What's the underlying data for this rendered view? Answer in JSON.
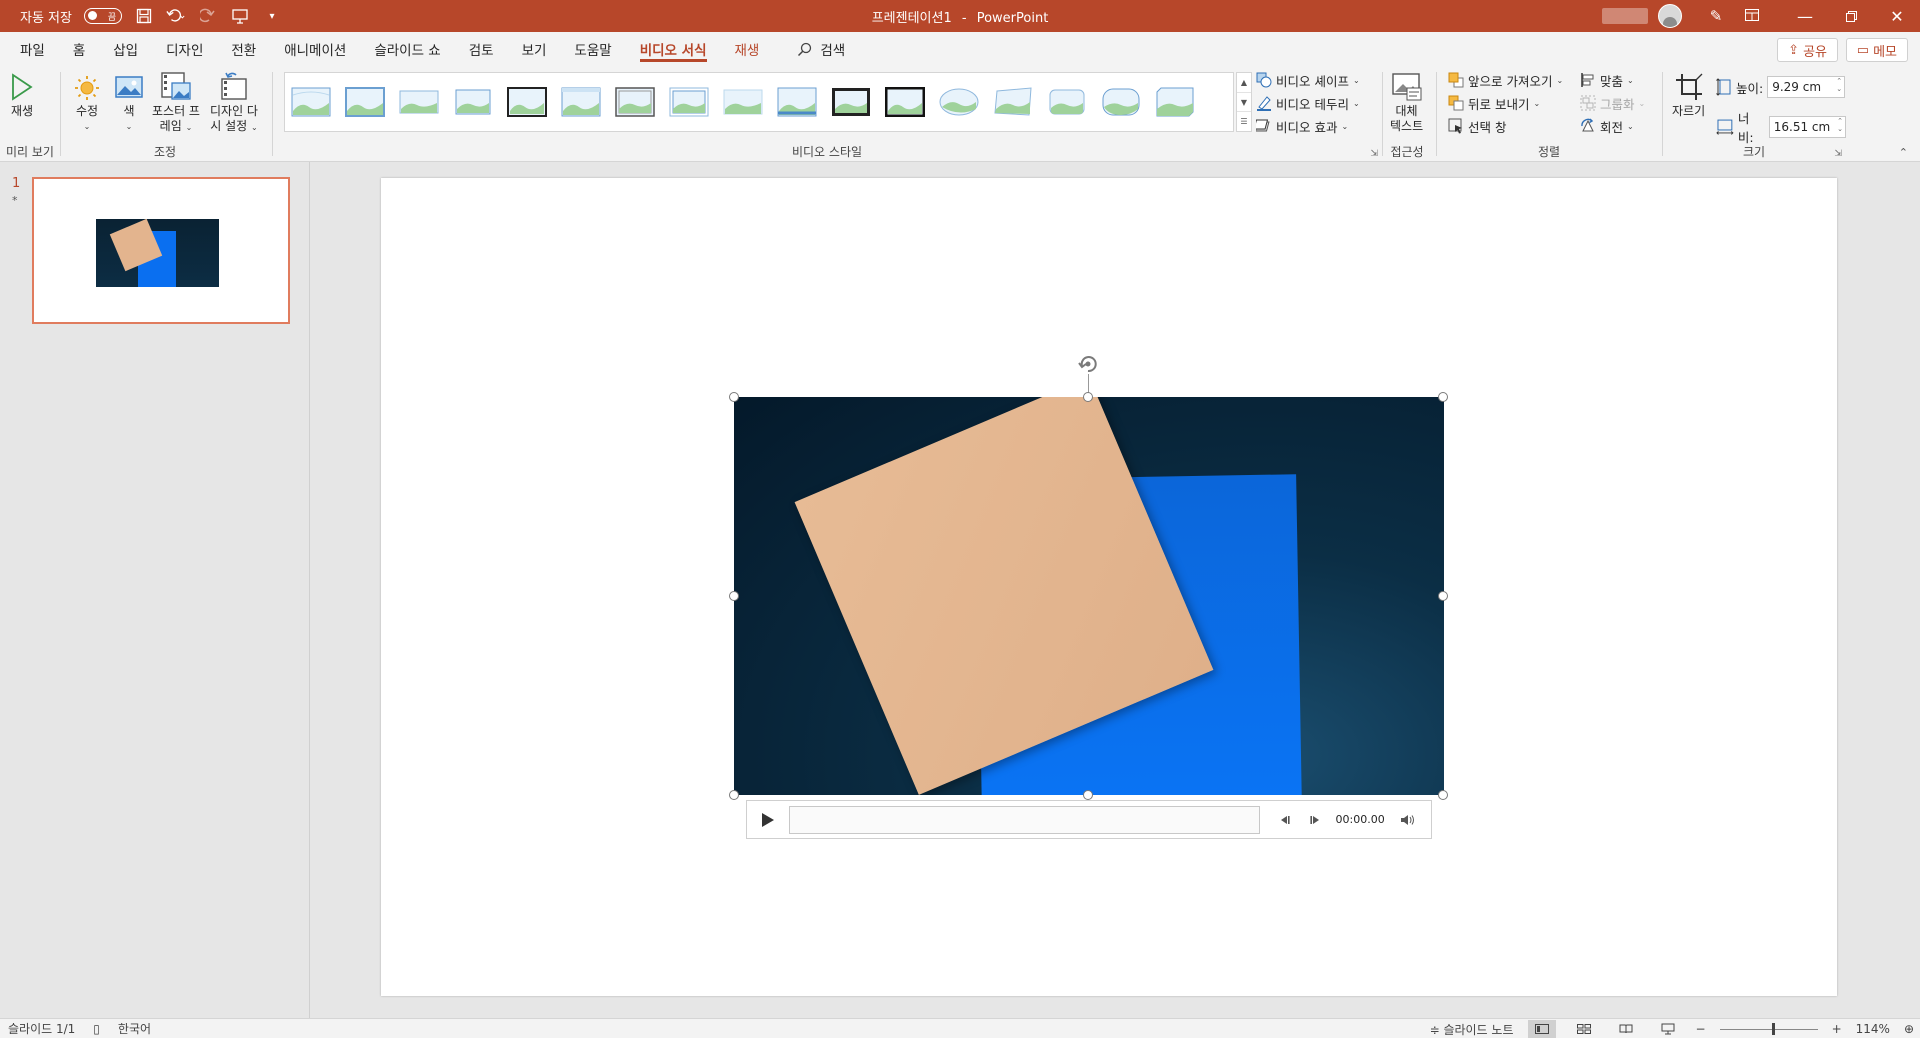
{
  "titlebar": {
    "autosave_label": "자동 저장",
    "autosave_state": "끔",
    "document_title": "프레젠테이션1",
    "separator": "-",
    "app_name": "PowerPoint"
  },
  "tabs": [
    {
      "label": "파일"
    },
    {
      "label": "홈"
    },
    {
      "label": "삽입"
    },
    {
      "label": "디자인"
    },
    {
      "label": "전환"
    },
    {
      "label": "애니메이션"
    },
    {
      "label": "슬라이드 쇼"
    },
    {
      "label": "검토"
    },
    {
      "label": "보기"
    },
    {
      "label": "도움말"
    },
    {
      "label": "비디오 서식"
    },
    {
      "label": "재생"
    }
  ],
  "search": {
    "label": "검색"
  },
  "actions": {
    "share": "공유",
    "comments": "메모"
  },
  "ribbon": {
    "preview": {
      "play": "재생",
      "group": "미리 보기"
    },
    "adjust": {
      "corrections": "수정",
      "color": "색",
      "poster_frame_1": "포스터 프",
      "poster_frame_2": "레임",
      "reset_design_1": "디자인 다",
      "reset_design_2": "시 설정",
      "group": "조정"
    },
    "styles": {
      "shape": "비디오 셰이프",
      "border": "비디오 테두리",
      "effects": "비디오 효과",
      "group": "비디오 스타일"
    },
    "accessibility": {
      "alt_text_1": "대체",
      "alt_text_2": "텍스트",
      "group": "접근성"
    },
    "arrange": {
      "bring_forward": "앞으로 가져오기",
      "send_backward": "뒤로 보내기",
      "selection_pane": "선택 창",
      "align": "맞춤",
      "group_btn": "그룹화",
      "rotate": "회전",
      "group": "정렬"
    },
    "size": {
      "crop": "자르기",
      "height_label": "높이:",
      "height_value": "9.29 cm",
      "width_label": "너비:",
      "width_value": "16.51 cm",
      "group": "크기"
    }
  },
  "slide_panel": {
    "slide_number": "1",
    "marker": "*"
  },
  "player": {
    "time": "00:00.00"
  },
  "status": {
    "slide_count": "슬라이드 1/1",
    "language": "한국어",
    "notes": "슬라이드 노트",
    "zoom": "114%"
  },
  "colors": {
    "accent": "#b7472a",
    "video_bg": "#0b2e45",
    "paper": "#e3b48e",
    "blue_sheet": "#0a6ff0"
  }
}
